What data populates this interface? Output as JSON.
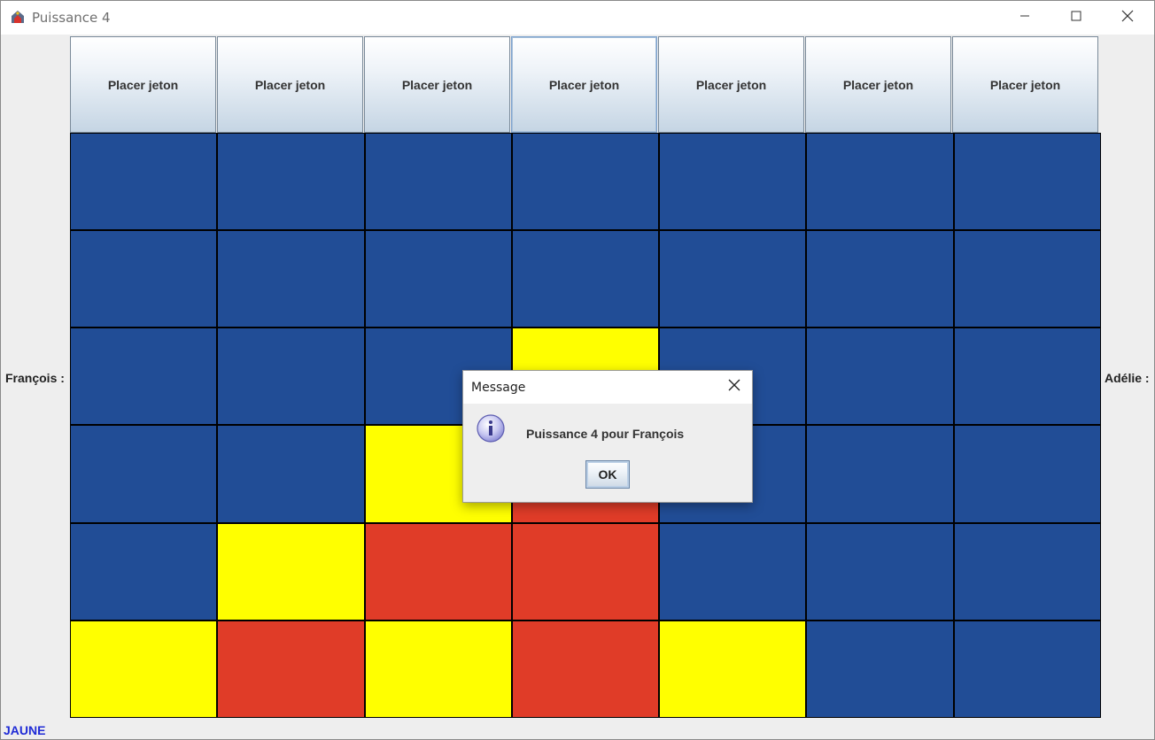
{
  "window": {
    "title": "Puissance 4",
    "icon": "java-cup-icon",
    "controls": [
      "minimize-icon",
      "maximize-icon",
      "close-icon"
    ]
  },
  "players": {
    "left_label": "François :",
    "right_label": "Adélie :"
  },
  "columns": [
    {
      "label": "Placer jeton"
    },
    {
      "label": "Placer jeton"
    },
    {
      "label": "Placer jeton"
    },
    {
      "label": "Placer jeton"
    },
    {
      "label": "Placer jeton"
    },
    {
      "label": "Placer jeton"
    },
    {
      "label": "Placer jeton"
    }
  ],
  "colors": {
    "empty": "#214d96",
    "yellow": "#ffff00",
    "red": "#e03c28",
    "status_text": "#1f2bd6"
  },
  "board": [
    [
      "empty",
      "empty",
      "empty",
      "empty",
      "empty",
      "empty",
      "empty"
    ],
    [
      "empty",
      "empty",
      "empty",
      "empty",
      "empty",
      "empty",
      "empty"
    ],
    [
      "empty",
      "empty",
      "empty",
      "yellow",
      "empty",
      "empty",
      "empty"
    ],
    [
      "empty",
      "empty",
      "yellow",
      "red",
      "empty",
      "empty",
      "empty"
    ],
    [
      "empty",
      "yellow",
      "red",
      "red",
      "empty",
      "empty",
      "empty"
    ],
    [
      "yellow",
      "red",
      "yellow",
      "red",
      "yellow",
      "empty",
      "empty"
    ]
  ],
  "status": {
    "text": "JAUNE"
  },
  "dialog": {
    "title": "Message",
    "icon": "info-icon",
    "message": "Puissance 4 pour François",
    "ok_label": "OK"
  }
}
